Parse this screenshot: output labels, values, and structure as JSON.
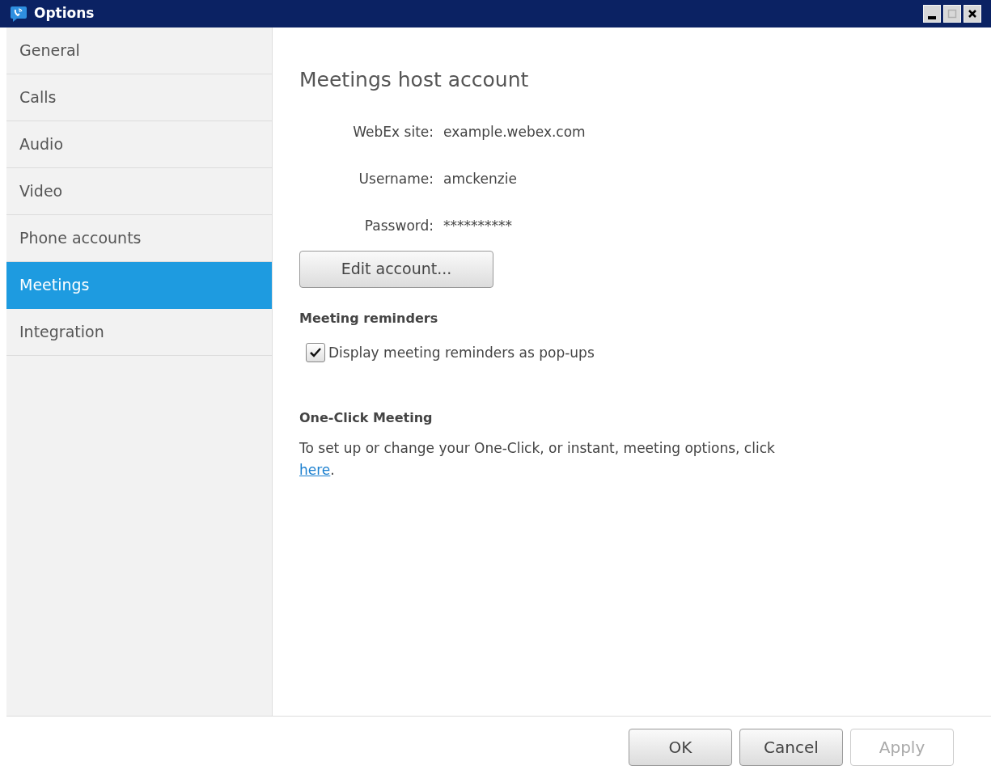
{
  "window": {
    "title": "Options",
    "controls": [
      {
        "kind": "minimize",
        "disabled": false
      },
      {
        "kind": "maximize",
        "disabled": true
      },
      {
        "kind": "close",
        "disabled": false
      }
    ]
  },
  "sidebar": {
    "items": [
      {
        "label": "General",
        "selected": false
      },
      {
        "label": "Calls",
        "selected": false
      },
      {
        "label": "Audio",
        "selected": false
      },
      {
        "label": "Video",
        "selected": false
      },
      {
        "label": "Phone accounts",
        "selected": false
      },
      {
        "label": "Meetings",
        "selected": true
      },
      {
        "label": "Integration",
        "selected": false
      }
    ]
  },
  "host_account": {
    "heading": "Meetings host account",
    "fields": [
      {
        "label": "WebEx site:",
        "value": "example.webex.com"
      },
      {
        "label": "Username:",
        "value": "amckenzie"
      },
      {
        "label": "Password:",
        "value": "**********"
      }
    ],
    "edit_button": "Edit account..."
  },
  "reminders": {
    "heading": "Meeting reminders",
    "checkbox": {
      "label": "Display meeting reminders as pop-ups",
      "checked": true
    }
  },
  "one_click": {
    "heading": "One-Click Meeting",
    "text": "To set up or change your One-Click, or instant, meeting options, click",
    "link": "here",
    "after_link": "."
  },
  "buttons": [
    {
      "label": "OK",
      "disabled": false
    },
    {
      "label": "Cancel",
      "disabled": false
    },
    {
      "label": "Apply",
      "disabled": true
    }
  ]
}
